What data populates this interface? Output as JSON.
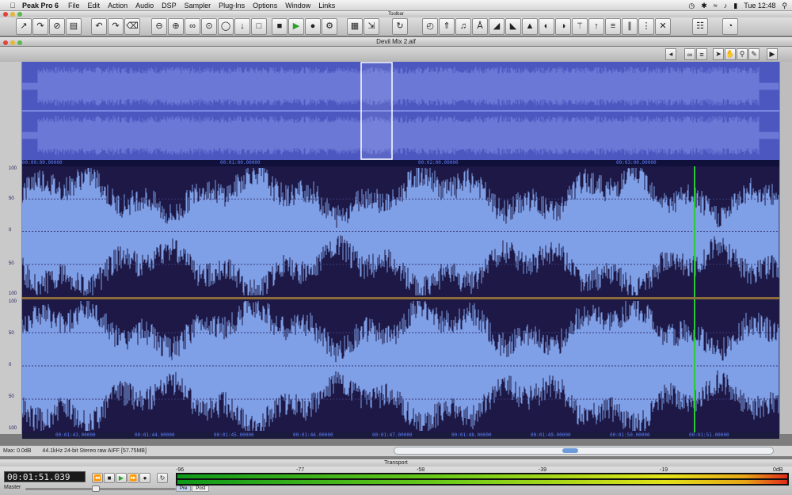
{
  "menubar": {
    "app_name": "Peak Pro 6",
    "menus": [
      "File",
      "Edit",
      "Action",
      "Audio",
      "DSP",
      "Sampler",
      "Plug-Ins",
      "Options",
      "Window",
      "Links"
    ],
    "clock": "Tue 12:48"
  },
  "toolbar": {
    "title": "Toolbar"
  },
  "document": {
    "title": "Devil Mix 2.aif",
    "overview_times": [
      "00:00:00.00000",
      "00:01:00.00000",
      "00:02:00.00000",
      "00:03:00.00000"
    ],
    "amplitude_labels": [
      "100",
      "50",
      "0",
      "50",
      "100"
    ],
    "bottom_times": [
      "00:01:43.00000",
      "00:01:44.00000",
      "00:01:45.00000",
      "00:01:46.00000",
      "00:01:47.00000",
      "00:01:48.00000",
      "00:01:49.00000",
      "00:01:50.00000",
      "00:01:51.00000"
    ]
  },
  "status": {
    "max": "Max: 0.0dB",
    "format": "44.1kHz 24-bit Stereo raw  AIFF [57.75MB]"
  },
  "transport": {
    "title": "Transport",
    "counter": "00:01:51.039",
    "master_label": "Master",
    "meter_scale": [
      "-96",
      "-77",
      "-58",
      "-39",
      "-19",
      "0dB"
    ],
    "pre_label": "Pre",
    "post_label": "Post"
  },
  "colors": {
    "waveform": "#7f9fe6",
    "background": "#1d1846",
    "playhead": "#2cc93a",
    "overview": "#4c58c0"
  }
}
